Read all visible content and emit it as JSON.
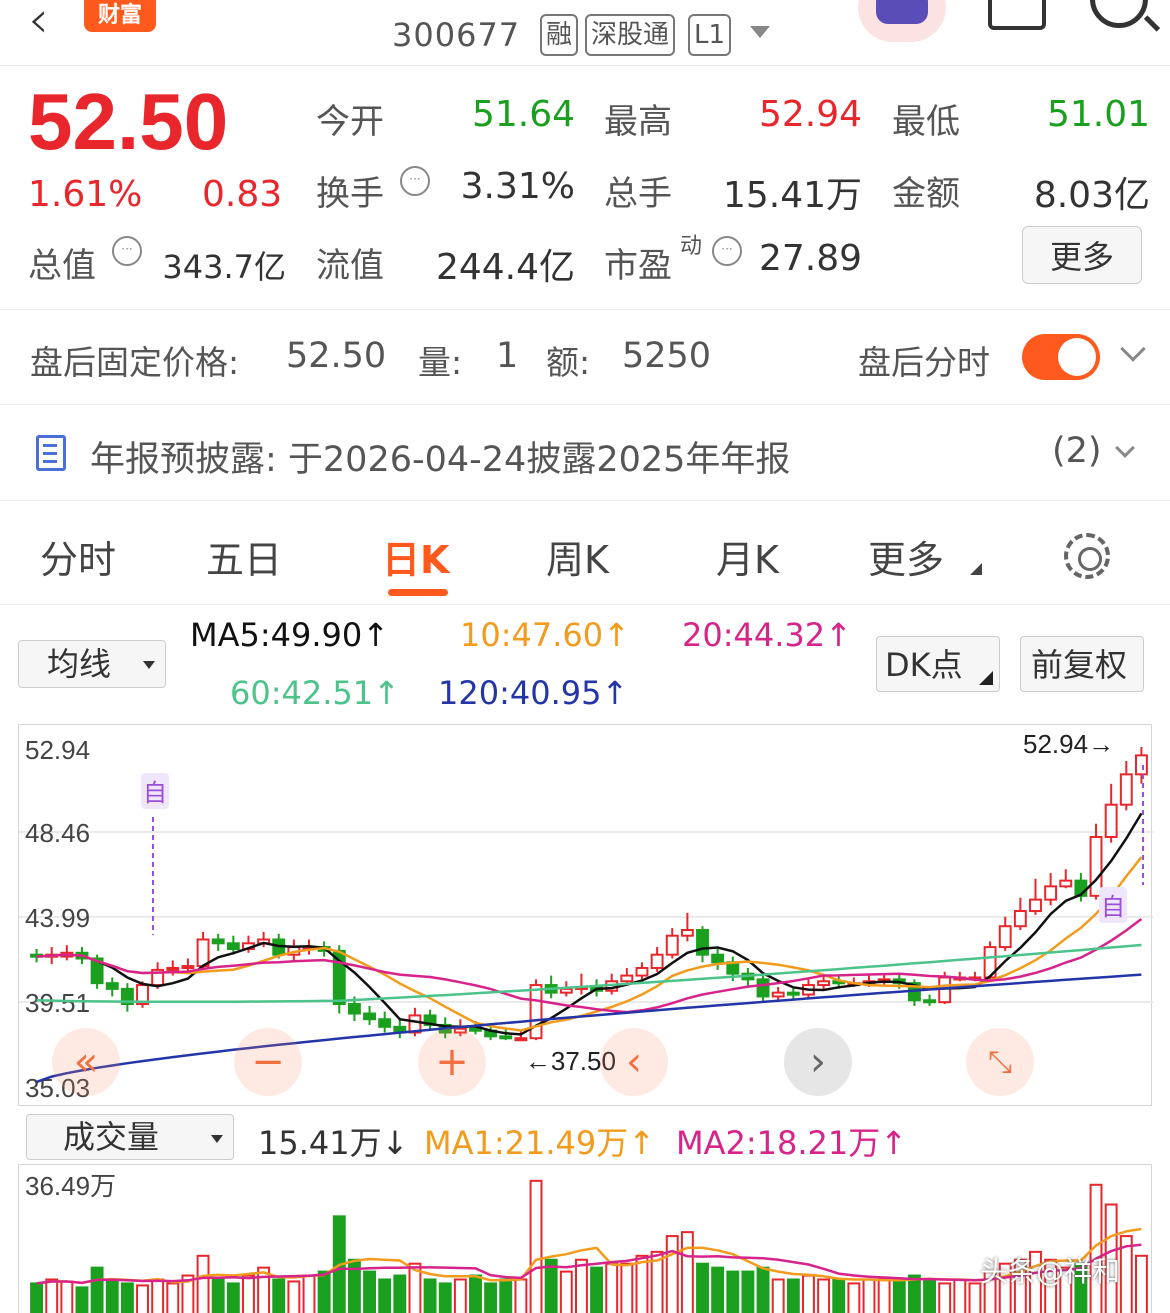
{
  "header": {
    "brand_badge": "财富",
    "stock_code": "300677",
    "tags": [
      "融",
      "深股通",
      "L1"
    ]
  },
  "quote": {
    "price": "52.50",
    "change_pct": "1.61%",
    "change_amt": "0.83",
    "rows": [
      [
        {
          "label": "今开",
          "value": "51.64",
          "color": "green"
        },
        {
          "label": "最高",
          "value": "52.94",
          "color": "red"
        },
        {
          "label": "最低",
          "value": "51.01",
          "color": "green"
        }
      ],
      [
        {
          "label": "换手",
          "value": "3.31%",
          "color": "dark"
        },
        {
          "label": "总手",
          "value": "15.41万",
          "color": "dark"
        },
        {
          "label": "金额",
          "value": "8.03亿",
          "color": "dark"
        }
      ],
      [
        {
          "label": "流值",
          "value": "244.4亿",
          "color": "dark"
        },
        {
          "label": "市盈",
          "value": "27.89",
          "color": "dark"
        }
      ]
    ],
    "total_value_label": "总值",
    "total_value": "343.7亿",
    "pe_superscript": "动",
    "more_label": "更多"
  },
  "after_hours": {
    "label": "盘后固定价格:",
    "price": "52.50",
    "vol_label": "量:",
    "vol": "1",
    "amt_label": "额:",
    "amt": "5250",
    "toggle_label": "盘后分时"
  },
  "notice": {
    "text": "年报预披露: 于2026-04-24披露2025年年报",
    "count": "(2)"
  },
  "tabs": [
    "分时",
    "五日",
    "日K",
    "周K",
    "月K",
    "更多"
  ],
  "ma_row": {
    "select": "均线",
    "ma5": "MA5:49.90↑",
    "ma10": "10:47.60↑",
    "ma20": "20:44.32↑",
    "ma60": "60:42.51↑",
    "ma120": "120:40.95↑",
    "dk_label": "DK点",
    "adjust_label": "前复权"
  },
  "colors": {
    "up": "#e8262b",
    "down": "#1aa01e",
    "accent": "#ff5a1e",
    "ma5": "#111111",
    "ma10": "#f29b1d",
    "ma20": "#d6248b",
    "ma60": "#4cc38a",
    "ma120": "#2435a8"
  },
  "chart_data": {
    "type": "candlestick",
    "y_ticks": [
      "52.94",
      "48.46",
      "43.99",
      "39.51",
      "35.03"
    ],
    "ylim": [
      35.03,
      52.94
    ],
    "max_label": "52.94→",
    "min_label": "←37.50",
    "self_marker": "自",
    "candles": [
      [
        42.0,
        41.9,
        42.3,
        41.6
      ],
      [
        41.9,
        42.0,
        42.4,
        41.5
      ],
      [
        41.9,
        42.1,
        42.5,
        41.7
      ],
      [
        42.1,
        41.8,
        42.4,
        41.5
      ],
      [
        41.8,
        40.5,
        42.0,
        40.2
      ],
      [
        40.5,
        40.2,
        40.8,
        39.8
      ],
      [
        40.2,
        39.4,
        40.5,
        39.0
      ],
      [
        39.4,
        40.4,
        40.6,
        39.2
      ],
      [
        40.4,
        41.2,
        41.6,
        40.2
      ],
      [
        41.2,
        41.3,
        41.7,
        40.9
      ],
      [
        41.3,
        41.4,
        41.8,
        41.0
      ],
      [
        41.4,
        42.8,
        43.2,
        41.2
      ],
      [
        42.8,
        42.6,
        43.1,
        42.2
      ],
      [
        42.6,
        42.3,
        43.0,
        42.0
      ],
      [
        42.3,
        42.6,
        43.0,
        42.1
      ],
      [
        42.6,
        42.8,
        43.2,
        42.4
      ],
      [
        42.8,
        42.0,
        43.1,
        41.8
      ],
      [
        42.0,
        42.4,
        42.8,
        41.7
      ],
      [
        42.4,
        42.4,
        42.8,
        42.0
      ],
      [
        42.4,
        42.2,
        42.7,
        41.9
      ],
      [
        42.2,
        39.4,
        42.5,
        38.9
      ],
      [
        39.4,
        38.9,
        39.8,
        38.5
      ],
      [
        38.9,
        38.6,
        39.3,
        38.3
      ],
      [
        38.6,
        38.2,
        39.0,
        37.9
      ],
      [
        38.2,
        37.9,
        38.6,
        37.6
      ],
      [
        37.9,
        38.8,
        39.2,
        37.7
      ],
      [
        38.8,
        38.3,
        39.1,
        38.0
      ],
      [
        38.3,
        37.9,
        38.7,
        37.6
      ],
      [
        37.9,
        38.1,
        38.6,
        37.7
      ],
      [
        38.1,
        38.0,
        38.5,
        37.8
      ],
      [
        38.0,
        37.7,
        38.3,
        37.5
      ],
      [
        37.7,
        37.6,
        38.1,
        37.5
      ],
      [
        37.6,
        37.6,
        38.0,
        37.5
      ],
      [
        37.6,
        40.4,
        40.7,
        37.5
      ],
      [
        40.4,
        40.0,
        40.9,
        39.7
      ],
      [
        40.0,
        40.2,
        40.6,
        39.8
      ],
      [
        40.2,
        40.3,
        41.0,
        39.9
      ],
      [
        40.3,
        40.1,
        40.7,
        39.8
      ],
      [
        40.1,
        40.6,
        41.0,
        39.9
      ],
      [
        40.6,
        40.9,
        41.3,
        40.4
      ],
      [
        40.9,
        41.3,
        41.6,
        40.7
      ],
      [
        41.3,
        42.0,
        42.4,
        41.1
      ],
      [
        42.0,
        43.0,
        43.4,
        41.8
      ],
      [
        43.0,
        43.3,
        44.2,
        42.7
      ],
      [
        43.3,
        42.0,
        43.5,
        41.6
      ],
      [
        42.0,
        41.6,
        42.3,
        41.2
      ],
      [
        41.6,
        41.0,
        41.9,
        40.6
      ],
      [
        41.0,
        40.7,
        41.3,
        40.3
      ],
      [
        40.7,
        39.8,
        41.0,
        39.5
      ],
      [
        39.8,
        40.0,
        40.3,
        39.6
      ],
      [
        40.0,
        39.9,
        40.3,
        39.6
      ],
      [
        39.9,
        40.4,
        40.7,
        39.7
      ],
      [
        40.4,
        40.6,
        40.9,
        40.2
      ],
      [
        40.6,
        40.5,
        40.9,
        40.2
      ],
      [
        40.5,
        40.5,
        40.8,
        40.3
      ],
      [
        40.5,
        40.6,
        40.9,
        40.3
      ],
      [
        40.6,
        40.7,
        41.0,
        40.4
      ],
      [
        40.7,
        40.5,
        41.0,
        40.2
      ],
      [
        40.5,
        39.6,
        40.7,
        39.3
      ],
      [
        39.6,
        39.5,
        39.9,
        39.3
      ],
      [
        39.5,
        40.8,
        41.1,
        39.4
      ],
      [
        40.8,
        40.8,
        41.1,
        40.6
      ],
      [
        40.8,
        40.8,
        41.1,
        40.6
      ],
      [
        40.8,
        42.4,
        42.7,
        40.7
      ],
      [
        42.4,
        43.5,
        44.0,
        42.2
      ],
      [
        43.5,
        44.3,
        45.0,
        43.3
      ],
      [
        44.3,
        44.9,
        46.0,
        44.1
      ],
      [
        44.9,
        45.6,
        46.3,
        44.6
      ],
      [
        45.6,
        45.9,
        46.5,
        45.5
      ],
      [
        45.9,
        45.1,
        46.3,
        44.8
      ],
      [
        45.1,
        48.2,
        48.9,
        44.9
      ],
      [
        48.2,
        49.9,
        51.0,
        47.9
      ],
      [
        49.9,
        51.5,
        52.2,
        49.6
      ],
      [
        51.5,
        52.5,
        52.94,
        51.01
      ]
    ],
    "volume": {
      "select": "成交量",
      "current": "15.41万↓",
      "ma1": "MA1:21.49万↑",
      "ma2": "MA2:18.21万↑",
      "max_label": "36.49万",
      "max": 36.49,
      "values": [
        8,
        9,
        8.5,
        7,
        12,
        9,
        8,
        7.5,
        9,
        8,
        10,
        15,
        9,
        8,
        10,
        12,
        9,
        8.5,
        10,
        11,
        25,
        14,
        11,
        9,
        10,
        13,
        9,
        8,
        9,
        10,
        8,
        9,
        9,
        34,
        14,
        11,
        14,
        12,
        13,
        13,
        15,
        16,
        20,
        21,
        13,
        12,
        11,
        11,
        12,
        9,
        9,
        10,
        9,
        9,
        8,
        9,
        9,
        9,
        10,
        9,
        8,
        9,
        8,
        11,
        13,
        14,
        16,
        14,
        12,
        13,
        33,
        28,
        20,
        15
      ]
    }
  },
  "watermark": "头条@祥和"
}
